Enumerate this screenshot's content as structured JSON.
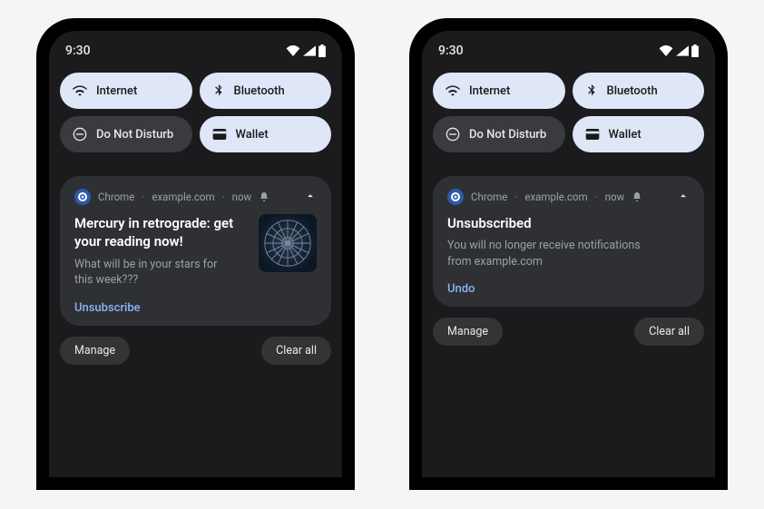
{
  "status": {
    "time": "9:30"
  },
  "qs": {
    "internet": "Internet",
    "bluetooth": "Bluetooth",
    "dnd": "Do Not Disturb",
    "wallet": "Wallet"
  },
  "notif1": {
    "app": "Chrome",
    "source": "example.com",
    "when": "now",
    "title": "Mercury in retrograde: get\nyour reading now!",
    "message": "What will be in your stars for\nthis week???",
    "action": "Unsubscribe"
  },
  "notif2": {
    "app": "Chrome",
    "source": "example.com",
    "when": "now",
    "title": "Unsubscribed",
    "message": "You will no longer receive notifications\nfrom example.com",
    "action": "Undo"
  },
  "footer": {
    "manage": "Manage",
    "clear": "Clear all"
  }
}
